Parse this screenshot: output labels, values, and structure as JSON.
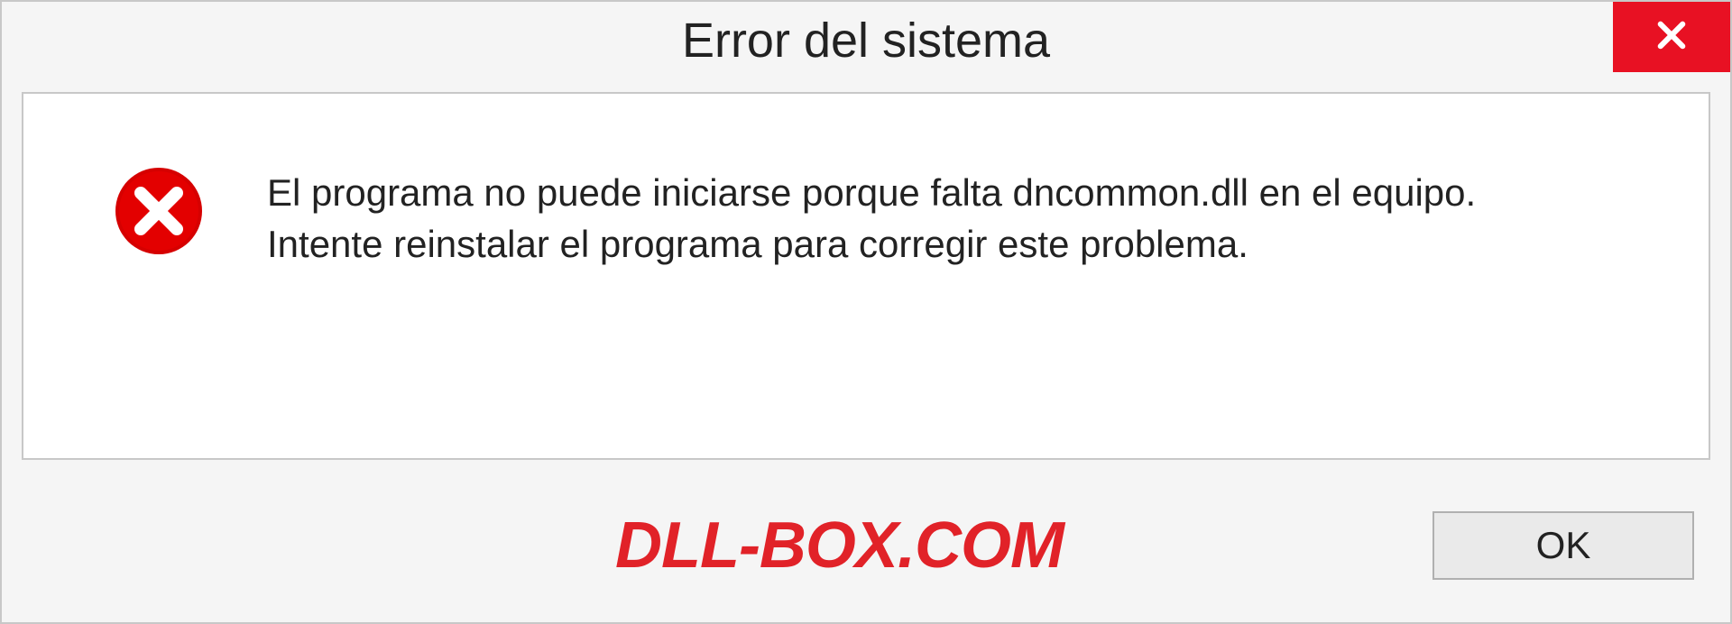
{
  "titlebar": {
    "title": "Error del sistema"
  },
  "message": {
    "line1": "El programa no puede iniciarse porque falta dncommon.dll en el equipo.",
    "line2": "Intente reinstalar el programa para corregir este problema."
  },
  "footer": {
    "watermark": "DLL-BOX.COM",
    "ok_label": "OK"
  },
  "colors": {
    "close_bg": "#e81123",
    "error_icon": "#d60000",
    "watermark": "#e12228"
  }
}
